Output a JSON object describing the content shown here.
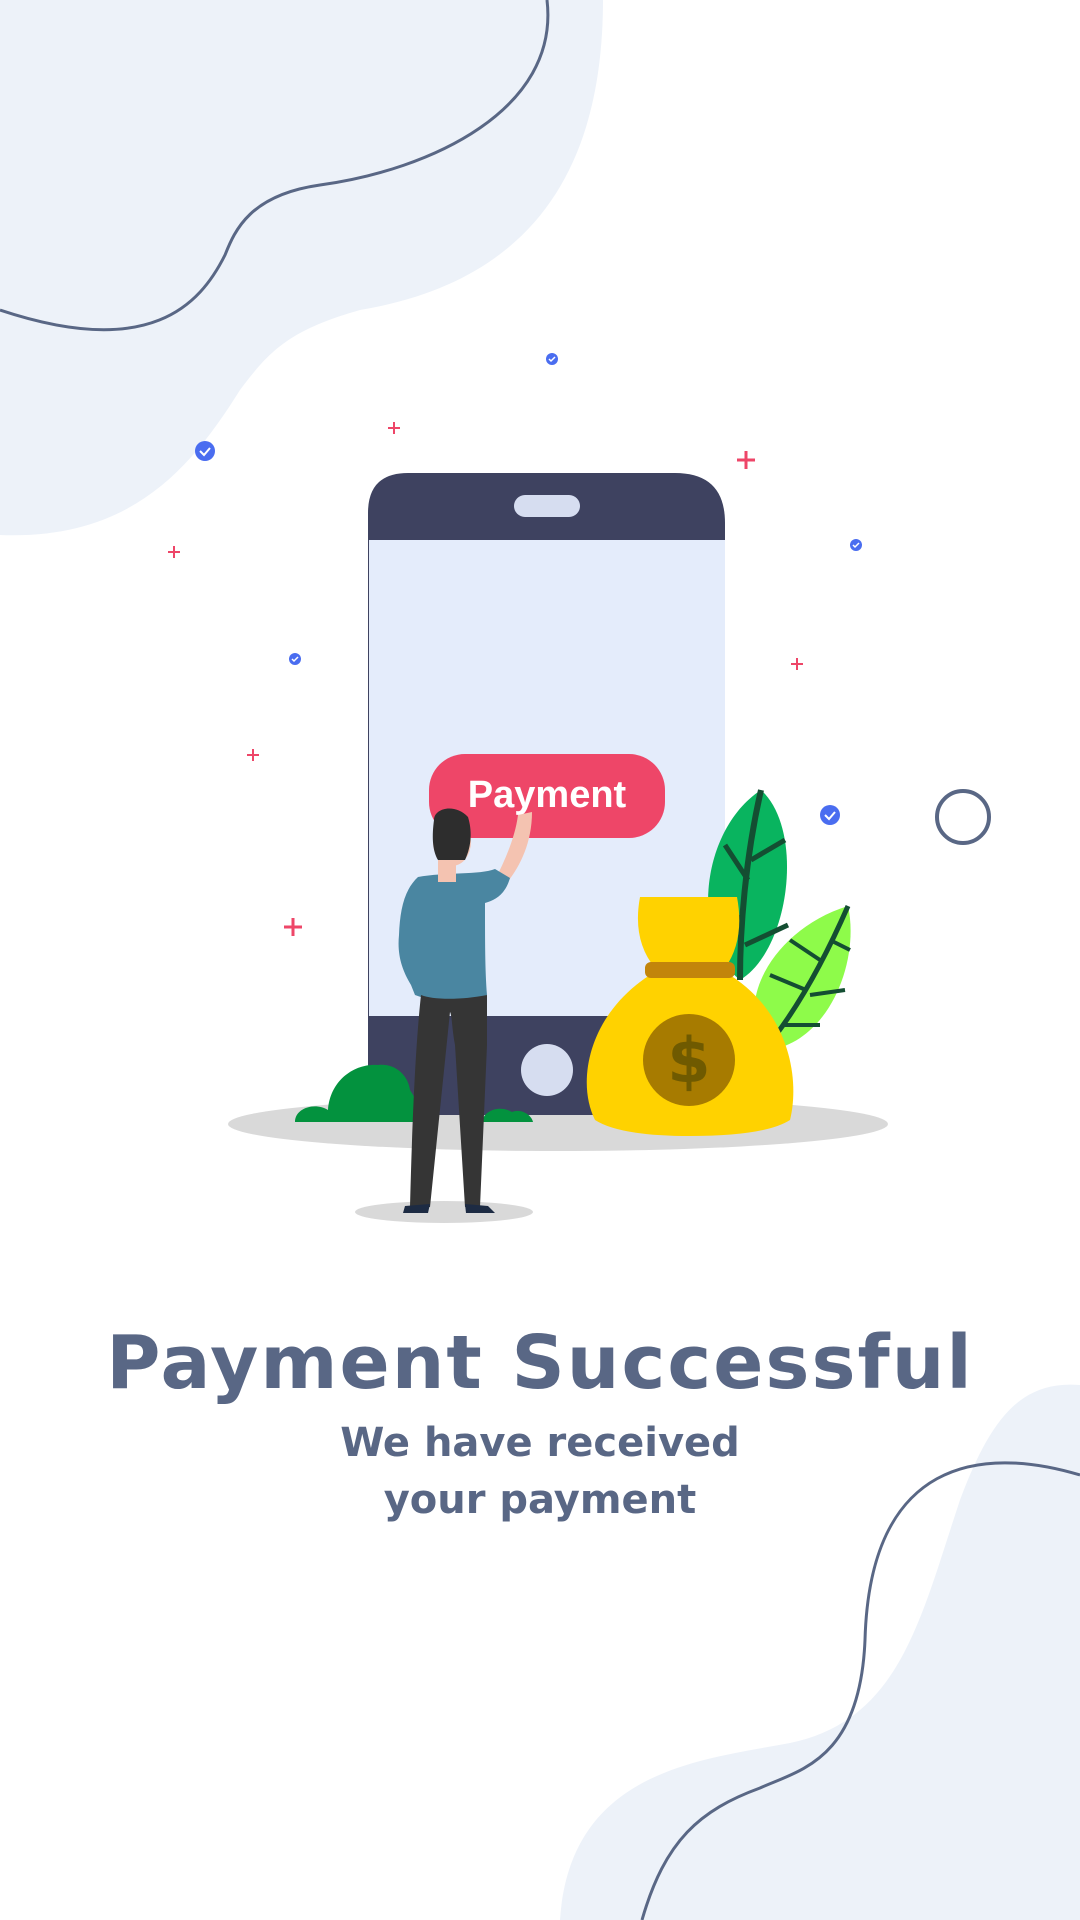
{
  "illustration": {
    "button_label": "Payment",
    "icons": {
      "phone": "smartphone-icon",
      "person": "person-icon",
      "money_bag": "money-bag-icon",
      "dollar": "dollar-sign-icon",
      "leaves": "leaf-icon",
      "bush": "bush-icon",
      "check_dot": "check-circle-icon",
      "plus_sparkle": "plus-icon",
      "ring": "ring-icon"
    },
    "colors": {
      "phone_body": "#3e4260",
      "phone_screen": "#e4ecfb",
      "button": "#ee4668",
      "bag": "#ffd200",
      "coin": "#a77b00",
      "leaf_dark": "#09b45f",
      "leaf_light": "#8efb4a",
      "shirt": "#4a86a1",
      "sparkle": "#ee4668",
      "check": "#4a6df0"
    }
  },
  "message": {
    "title": "Payment Successful",
    "subtitle": "We have received your payment"
  },
  "theme": {
    "background": "#ffffff",
    "blob": "#edf2f9",
    "line": "#596785",
    "text": "#596785"
  }
}
